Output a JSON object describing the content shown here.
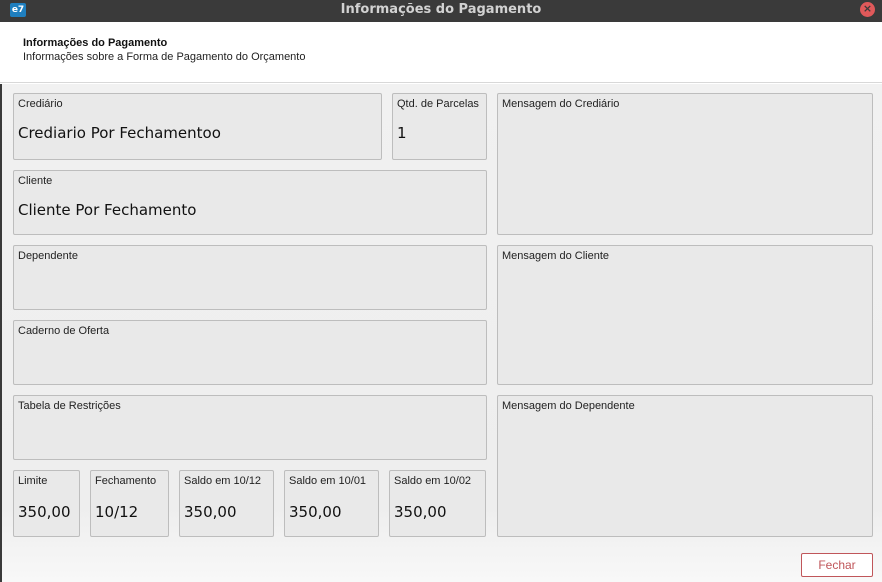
{
  "window": {
    "title": "Informações do Pagamento",
    "app_icon": "app-logo",
    "close_icon": "close-icon"
  },
  "header": {
    "title": "Informações do Pagamento",
    "subtitle": "Informações sobre a Forma de Pagamento do Orçamento"
  },
  "fields": {
    "crediario": {
      "label": "Crediário",
      "value": "Crediario Por Fechamentoo"
    },
    "parcelas": {
      "label": "Qtd. de Parcelas",
      "value": "1"
    },
    "cliente": {
      "label": "Cliente",
      "value": "Cliente Por Fechamento"
    },
    "dependente": {
      "label": "Dependente",
      "value": ""
    },
    "caderno": {
      "label": "Caderno de Oferta",
      "value": ""
    },
    "tabela": {
      "label": "Tabela de Restrições",
      "value": ""
    },
    "limite": {
      "label": "Limite",
      "value": "350,00"
    },
    "fechamento": {
      "label": "Fechamento",
      "value": "10/12"
    },
    "saldo1": {
      "label": "Saldo em 10/12",
      "value": "350,00"
    },
    "saldo2": {
      "label": "Saldo em 10/01",
      "value": "350,00"
    },
    "saldo3": {
      "label": "Saldo em 10/02",
      "value": "350,00"
    },
    "msg_crediario": {
      "label": "Mensagem do Crediário",
      "value": ""
    },
    "msg_cliente": {
      "label": "Mensagem do Cliente",
      "value": ""
    },
    "msg_dependente": {
      "label": "Mensagem do Dependente",
      "value": ""
    }
  },
  "footer": {
    "close_label": "Fechar"
  },
  "colors": {
    "titlebar": "#3a3a3a",
    "close_button": "#e0595a",
    "field_bg": "#e9e9e9",
    "accent": "#c0565a"
  }
}
